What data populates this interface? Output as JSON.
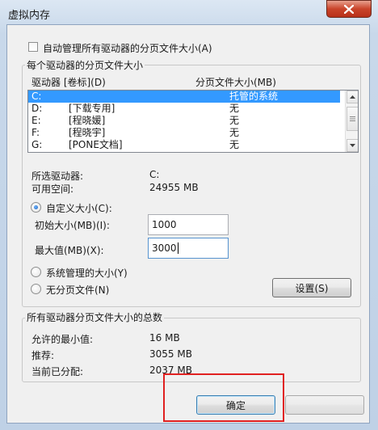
{
  "window": {
    "title": "虚拟内存"
  },
  "auto_manage": {
    "label": "自动管理所有驱动器的分页文件大小(A)",
    "checked": false
  },
  "per_drive_group": {
    "legend": "每个驱动器的分页文件大小",
    "columns": {
      "drive": "驱动器 [卷标](D)",
      "size": "分页文件大小(MB)"
    },
    "drives": [
      {
        "drive": "C:",
        "label": "",
        "size": "托管的系统",
        "selected": true
      },
      {
        "drive": "D:",
        "label": "[下载专用]",
        "size": "无",
        "selected": false
      },
      {
        "drive": "E:",
        "label": "[程晓媛]",
        "size": "无",
        "selected": false
      },
      {
        "drive": "F:",
        "label": "[程晓宇]",
        "size": "无",
        "selected": false
      },
      {
        "drive": "G:",
        "label": "[PONE文档]",
        "size": "无",
        "selected": false
      }
    ],
    "selected_drive_label": "所选驱动器:",
    "selected_drive_value": "C:",
    "free_space_label": "可用空间:",
    "free_space_value": "24955 MB",
    "custom_size": {
      "label": "自定义大小(C):",
      "checked": true
    },
    "initial_size": {
      "label": "初始大小(MB)(I):",
      "value": "1000"
    },
    "max_size": {
      "label": "最大值(MB)(X):",
      "value": "3000"
    },
    "system_managed": {
      "label": "系统管理的大小(Y)",
      "checked": false
    },
    "no_paging": {
      "label": "无分页文件(N)",
      "checked": false
    },
    "set_button": "设置(S)"
  },
  "totals_group": {
    "legend": "所有驱动器分页文件大小的总数",
    "min_allowed_label": "允许的最小值:",
    "min_allowed_value": "16 MB",
    "recommended_label": "推荐:",
    "recommended_value": "3055 MB",
    "allocated_label": "当前已分配:",
    "allocated_value": "2037 MB"
  },
  "buttons": {
    "ok": "确定",
    "cancel": ""
  },
  "colors": {
    "selection": "#3399ff",
    "highlight_box": "#e02020",
    "title_bar": "#c8d8ea",
    "close_button": "#c9442a"
  }
}
